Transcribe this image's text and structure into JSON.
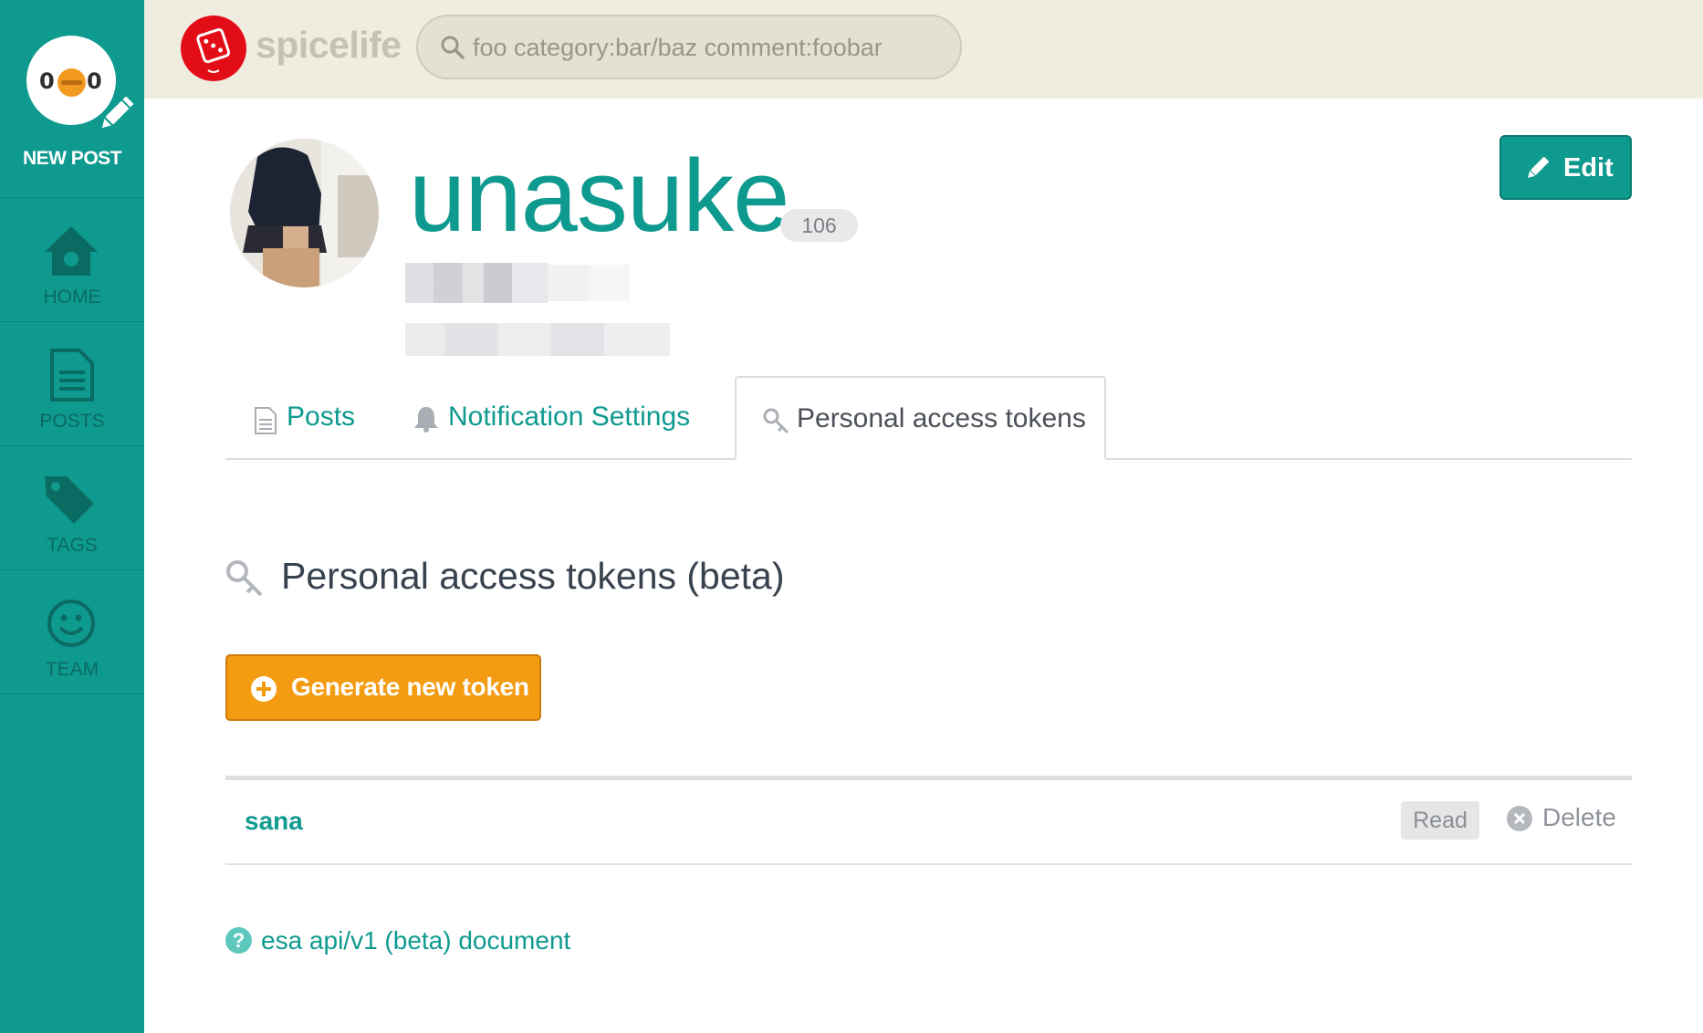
{
  "sidebar": {
    "new_post_label": "NEW POST",
    "logo_left": "0",
    "logo_right": "0",
    "items": [
      {
        "label": "HOME",
        "icon": "home-icon"
      },
      {
        "label": "POSTS",
        "icon": "document-icon"
      },
      {
        "label": "TAGS",
        "icon": "tags-icon"
      },
      {
        "label": "TEAM",
        "icon": "smiley-icon"
      }
    ]
  },
  "header": {
    "team_name": "spicelife",
    "search_placeholder": "foo category:bar/baz comment:foobar"
  },
  "profile": {
    "username": "unasuke",
    "post_count": "106",
    "edit_label": "Edit"
  },
  "tabs": [
    {
      "label": "Posts",
      "icon": "document-icon",
      "active": false
    },
    {
      "label": "Notification Settings",
      "icon": "bell-icon",
      "active": false
    },
    {
      "label": "Personal access tokens",
      "icon": "key-icon",
      "active": true
    }
  ],
  "tokens_section": {
    "title": "Personal access tokens (beta)",
    "generate_label": "Generate new token",
    "tokens": [
      {
        "name": "sana",
        "scope": "Read",
        "delete_label": "Delete"
      }
    ],
    "doc_link_label": "esa api/v1 (beta) document"
  },
  "colors": {
    "primary": "#0f9a8f",
    "accent": "#f39c12",
    "header_bg": "#efede0",
    "logo_red": "#e30d17"
  }
}
